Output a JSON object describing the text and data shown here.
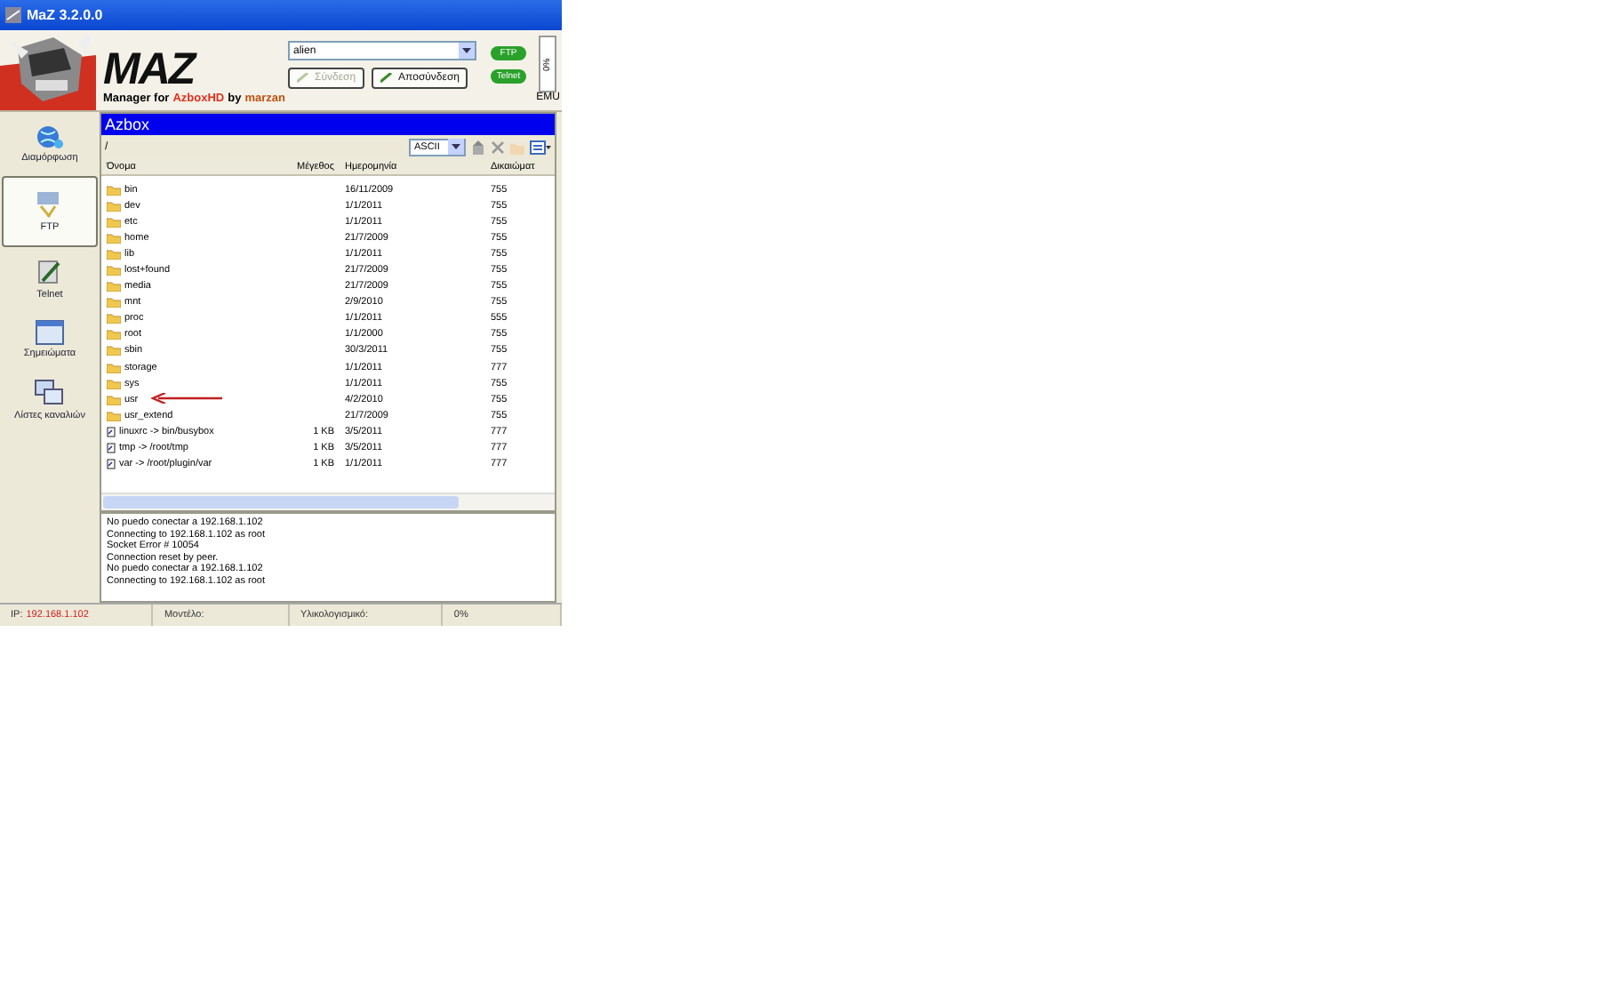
{
  "window": {
    "title": "MaZ 3.2.0.0"
  },
  "header": {
    "logo": "MAZ",
    "tagline": [
      {
        "text": "Manager for",
        "color": "#000000"
      },
      {
        "text": "AzboxHD",
        "color": "#e03020"
      },
      {
        "text": "by",
        "color": "#000000"
      },
      {
        "text": "marzan",
        "color": "#c05010"
      }
    ],
    "receiver": "alien",
    "connect": {
      "label": "Σύνδεση",
      "disabled": true
    },
    "disconnect": {
      "label": "Αποσύνδεση",
      "disabled": false
    },
    "pills": [
      "FTP",
      "Telnet"
    ],
    "gauge": "0%",
    "emu": "EMU"
  },
  "sidebar": {
    "items": [
      {
        "label": "Διαμόρφωση",
        "selected": false
      },
      {
        "label": "FTP",
        "selected": true
      },
      {
        "label": "Telnet",
        "selected": false
      },
      {
        "label": "Σημειώματα",
        "selected": false
      },
      {
        "label": "Λίστες καναλιών",
        "selected": false
      }
    ]
  },
  "panel": {
    "title": "Azbox",
    "path": "/",
    "mode": "ASCII"
  },
  "table": {
    "columns": [
      "Όνομα",
      "Μέγεθος",
      "Ημερομηνία",
      "Δικαιώματ"
    ],
    "rows": [
      {
        "kind": "folder",
        "name": "bin",
        "size": "",
        "date": "16/11/2009",
        "perm": "755"
      },
      {
        "kind": "folder",
        "name": "dev",
        "size": "",
        "date": "1/1/2011",
        "perm": "755"
      },
      {
        "kind": "folder",
        "name": "etc",
        "size": "",
        "date": "1/1/2011",
        "perm": "755"
      },
      {
        "kind": "folder",
        "name": "home",
        "size": "",
        "date": "21/7/2009",
        "perm": "755"
      },
      {
        "kind": "folder",
        "name": "lib",
        "size": "",
        "date": "1/1/2011",
        "perm": "755"
      },
      {
        "kind": "folder",
        "name": "lost+found",
        "size": "",
        "date": "21/7/2009",
        "perm": "755"
      },
      {
        "kind": "folder",
        "name": "media",
        "size": "",
        "date": "21/7/2009",
        "perm": "755"
      },
      {
        "kind": "folder",
        "name": "mnt",
        "size": "",
        "date": "2/9/2010",
        "perm": "755"
      },
      {
        "kind": "folder",
        "name": "proc",
        "size": "",
        "date": "1/1/2011",
        "perm": "555"
      },
      {
        "kind": "folder",
        "name": "root",
        "size": "",
        "date": "1/1/2000",
        "perm": "755"
      },
      {
        "kind": "folder",
        "name": "sbin",
        "size": "",
        "date": "30/3/2011",
        "perm": "755"
      },
      {
        "kind": "folder",
        "name": "storage",
        "size": "",
        "date": "1/1/2011",
        "perm": "777"
      },
      {
        "kind": "folder",
        "name": "sys",
        "size": "",
        "date": "1/1/2011",
        "perm": "755"
      },
      {
        "kind": "folder",
        "name": "usr",
        "size": "",
        "date": "4/2/2010",
        "perm": "755",
        "arrow": true
      },
      {
        "kind": "folder",
        "name": "usr_extend",
        "size": "",
        "date": "21/7/2009",
        "perm": "755"
      },
      {
        "kind": "link",
        "name": "linuxrc -> bin/busybox",
        "size": "1 KB",
        "date": "3/5/2011",
        "perm": "777"
      },
      {
        "kind": "link",
        "name": "tmp -> /root/tmp",
        "size": "1 KB",
        "date": "3/5/2011",
        "perm": "777"
      },
      {
        "kind": "link",
        "name": "var -> /root/plugin/var",
        "size": "1 KB",
        "date": "1/1/2011",
        "perm": "777"
      }
    ]
  },
  "log": [
    "No puedo conectar a 192.168.1.102",
    "Connecting to 192.168.1.102 as root",
    "Socket Error # 10054",
    "Connection reset by peer.",
    "No puedo conectar a 192.168.1.102",
    "Connecting to 192.168.1.102 as root"
  ],
  "status_bar": {
    "ip_label": "IP:",
    "ip": "192.168.1.102",
    "model": "Μοντέλο:",
    "firmware": "Υλικολογισμικό:",
    "progress": "0%"
  }
}
